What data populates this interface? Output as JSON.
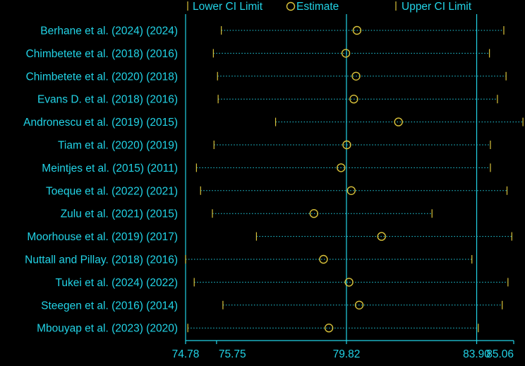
{
  "chart_data": {
    "type": "forest",
    "legend": {
      "lower": "Lower CI Limit",
      "estimate": "Estimate",
      "upper": "Upper CI Limit",
      "placement": "top"
    },
    "studies": [
      {
        "label": "Berhane et al. (2024) (2024)",
        "lower": 75.9,
        "estimate": 80.15,
        "upper": 84.75
      },
      {
        "label": "Chimbetete et al. (2018) (2016)",
        "lower": 75.65,
        "estimate": 79.8,
        "upper": 84.3
      },
      {
        "label": "Chimbetete et al. (2020) (2018)",
        "lower": 75.78,
        "estimate": 80.12,
        "upper": 84.82
      },
      {
        "label": "Evans D. et al. (2018) (2016)",
        "lower": 75.8,
        "estimate": 80.05,
        "upper": 84.55
      },
      {
        "label": "Andronescu et al. (2019) (2015)",
        "lower": 77.6,
        "estimate": 81.45,
        "upper": 85.35
      },
      {
        "label": "Tiam et al. (2020) (2019)",
        "lower": 75.67,
        "estimate": 79.83,
        "upper": 84.33
      },
      {
        "label": "Meintjes et al. (2015) (2011)",
        "lower": 75.12,
        "estimate": 79.65,
        "upper": 84.33
      },
      {
        "label": "Toeque et al. (2022) (2021)",
        "lower": 75.25,
        "estimate": 79.97,
        "upper": 84.85
      },
      {
        "label": "Zulu et al. (2021) (2015)",
        "lower": 75.62,
        "estimate": 78.8,
        "upper": 82.5
      },
      {
        "label": "Moorhouse et al. (2019) (2017)",
        "lower": 77.0,
        "estimate": 80.92,
        "upper": 85.0
      },
      {
        "label": "Nuttall and Pillay. (2018) (2016)",
        "lower": 74.78,
        "estimate": 79.1,
        "upper": 83.75
      },
      {
        "label": "Tukei et al. (2024) (2022)",
        "lower": 75.05,
        "estimate": 79.9,
        "upper": 84.88
      },
      {
        "label": "Steegen et al. (2016) (2014)",
        "lower": 75.95,
        "estimate": 80.22,
        "upper": 84.7
      },
      {
        "label": "Mbouyap et al. (2023) (2020)",
        "lower": 74.85,
        "estimate": 79.27,
        "upper": 83.95
      }
    ],
    "x_ticks": [
      74.78,
      75.75,
      79.82,
      83.9,
      85.06
    ],
    "x_tick_labels": [
      "74.78",
      "75.75",
      "79.82",
      "83.90",
      "85.06"
    ],
    "reference_lines": [
      74.78,
      79.82,
      83.9
    ],
    "xlim": [
      74.78,
      85.06
    ],
    "colors": {
      "background": "#000000",
      "text": "#22d3e6",
      "marker": "#d9c23a"
    }
  }
}
